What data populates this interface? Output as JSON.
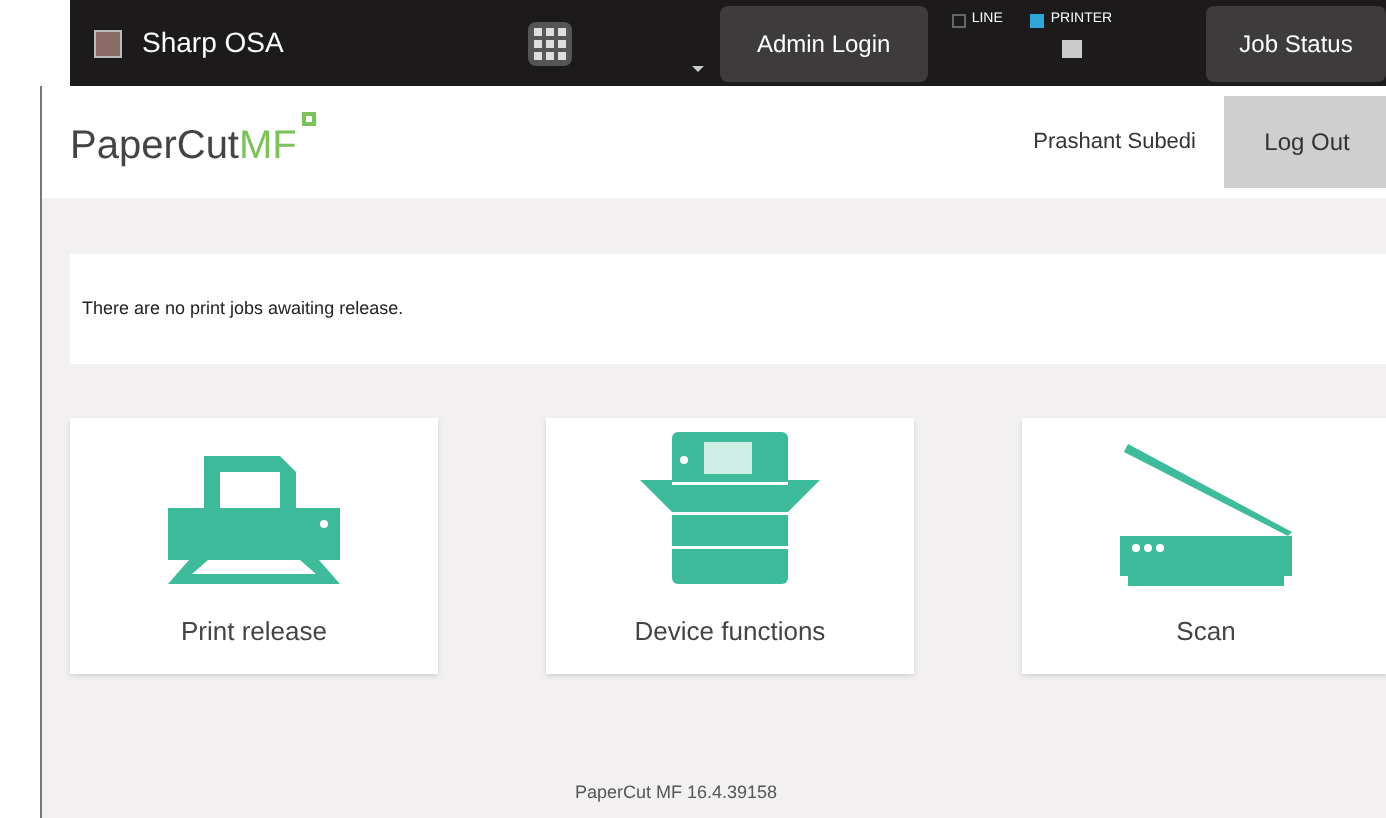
{
  "top_bar": {
    "app_name": "Sharp OSA",
    "admin_button": "Admin Login",
    "indicators": [
      {
        "label": "LINE",
        "on": false
      },
      {
        "label": "PRINTER",
        "on": true
      }
    ],
    "job_status_button": "Job Status"
  },
  "header": {
    "logo": {
      "main": "PaperCut",
      "accent": "MF"
    },
    "user_name": "Prashant Subedi",
    "logout_button": "Log Out"
  },
  "message": "There are no print jobs awaiting release.",
  "tiles": [
    {
      "kind": "printer",
      "label": "Print release"
    },
    {
      "kind": "copier",
      "label": "Device functions"
    },
    {
      "kind": "scanner",
      "label": "Scan"
    }
  ],
  "footer": "PaperCut MF 16.4.39158"
}
